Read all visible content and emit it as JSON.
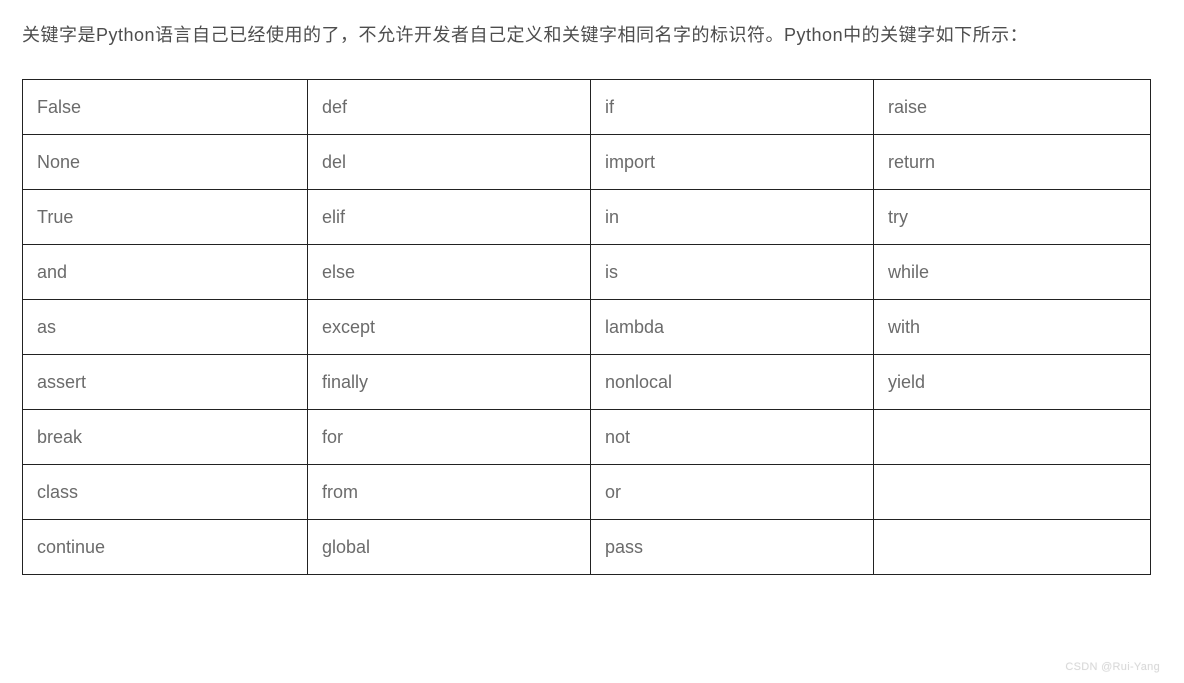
{
  "intro": "关键字是Python语言自己已经使用的了，不允许开发者自己定义和关键字相同名字的标识符。Python中的关键字如下所示：",
  "table": {
    "rows": [
      [
        "False",
        "def",
        "if",
        "raise"
      ],
      [
        "None",
        "del",
        "import",
        "return"
      ],
      [
        "True",
        "elif",
        "in",
        "try"
      ],
      [
        "and",
        "else",
        "is",
        "while"
      ],
      [
        "as",
        "except",
        "lambda",
        "with"
      ],
      [
        "assert",
        "finally",
        "nonlocal",
        "yield"
      ],
      [
        "break",
        "for",
        "not",
        ""
      ],
      [
        "class",
        "from",
        "or",
        ""
      ],
      [
        "continue",
        "global",
        "pass",
        ""
      ]
    ]
  },
  "watermark": "CSDN @Rui-Yang"
}
